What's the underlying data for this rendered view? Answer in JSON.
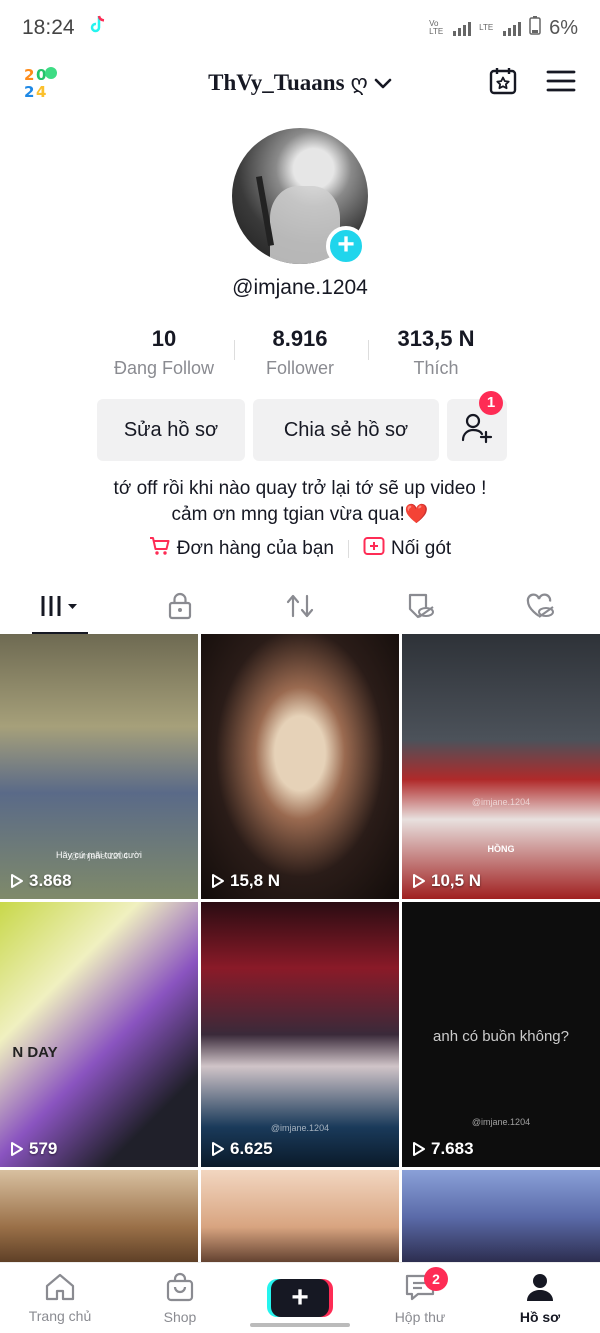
{
  "status_bar": {
    "time": "18:24",
    "battery": "6%",
    "carrier_tag1": "Vo LTE",
    "carrier_tag2": "LTE"
  },
  "header": {
    "logo": "2024",
    "username": "ThVy_Tuaans",
    "username_suffix": "ღ"
  },
  "profile": {
    "handle": "@imjane.1204",
    "stats": [
      {
        "value": "10",
        "label": "Đang Follow"
      },
      {
        "value": "8.916",
        "label": "Follower"
      },
      {
        "value": "313,5 N",
        "label": "Thích"
      }
    ],
    "edit_label": "Sửa hồ sơ",
    "share_label": "Chia sẻ hồ sơ",
    "add_friend_badge": "1",
    "bio_line1": "tớ off rồi khi nào quay trở lại tớ sẽ up video !",
    "bio_line2": "cảm ơn mng tgian vừa qua!❤️",
    "orders_label": "Đơn hàng của bạn",
    "fund_label": "Nối gót"
  },
  "videos": [
    {
      "views": "3.868",
      "caption": "Hãy cứ mãi tươi cười",
      "watermark": "@imjane.1204",
      "bg": "#8c8a6e"
    },
    {
      "views": "15,8 N",
      "bg": "#3a2a24"
    },
    {
      "views": "10,5 N",
      "caption": "HỒNG",
      "watermark": "@imjane.1204",
      "bg": "#4a4e55"
    },
    {
      "views": "579",
      "caption": "N DAY",
      "bg": "#9b6fc0"
    },
    {
      "views": "6.625",
      "watermark": "@imjane.1204",
      "bg": "#5a2a3a"
    },
    {
      "views": "7.683",
      "caption": "anh có buồn không?",
      "watermark": "@imjane.1204",
      "bg": "#0d0d0d"
    },
    {
      "bg": "#b59872"
    },
    {
      "bg": "#e8c2a0"
    },
    {
      "bg": "#6a7aa8"
    }
  ],
  "bottom_nav": {
    "home": "Trang chủ",
    "shop": "Shop",
    "inbox": "Hộp thư",
    "inbox_badge": "2",
    "profile": "Hồ sơ"
  },
  "colors": {
    "accent_red": "#fe2c55",
    "accent_cyan": "#20d5ec"
  }
}
